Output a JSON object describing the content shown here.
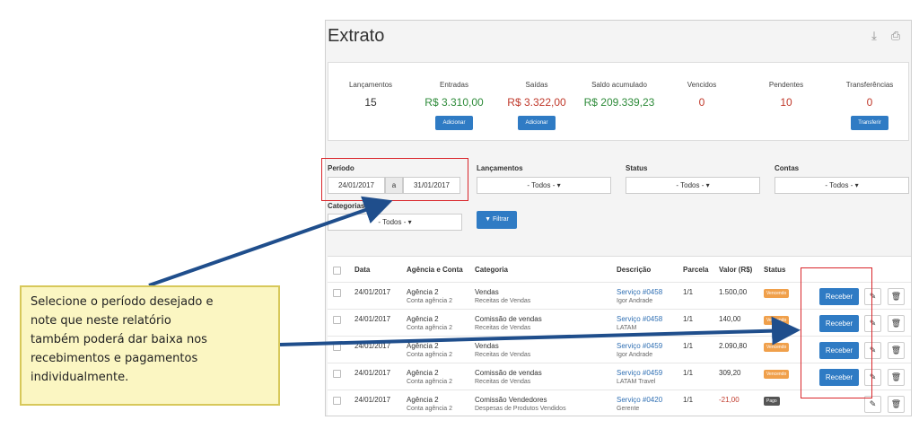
{
  "header": {
    "title": "Extrato",
    "download_icon": "download-icon",
    "print_icon": "print-icon"
  },
  "summary": {
    "lancamentos": {
      "label": "Lançamentos",
      "value": "15"
    },
    "entradas": {
      "label": "Entradas",
      "value": "R$ 3.310,00",
      "button": "Adicionar"
    },
    "saidas": {
      "label": "Saídas",
      "value": "R$ 3.322,00",
      "button": "Adicionar"
    },
    "saldo": {
      "label": "Saldo acumulado",
      "value": "R$ 209.339,23"
    },
    "vencidos": {
      "label": "Vencidos",
      "value": "0"
    },
    "pendentes": {
      "label": "Pendentes",
      "value": "10"
    },
    "transferencias": {
      "label": "Transferências",
      "value": "0",
      "button": "Transferir"
    }
  },
  "filters": {
    "periodo_label": "Período",
    "date_from": "24/01/2017",
    "date_sep": "a",
    "date_to": "31/01/2017",
    "lancamentos_label": "Lançamentos",
    "lancamentos_value": "- Todos -",
    "status_label": "Status",
    "status_value": "- Todos -",
    "contas_label": "Contas",
    "contas_value": "- Todos -",
    "categorias_label": "Categorias",
    "categorias_value": "- Todos -",
    "filter_button": "Filtrar"
  },
  "table": {
    "headers": {
      "data": "Data",
      "agencia": "Agência e Conta",
      "categoria": "Categoria",
      "descricao": "Descrição",
      "parcela": "Parcela",
      "valor": "Valor (R$)",
      "status": "Status"
    },
    "rows": [
      {
        "data": "24/01/2017",
        "agencia": "Agência 2",
        "conta": "Conta agência 2",
        "categoria": "Vendas",
        "subcategoria": "Receitas de Vendas",
        "descricao": "Serviço #0458",
        "cliente": "Igor Andrade",
        "parcela": "1/1",
        "valor": "1.500,00",
        "status": "Vencendo",
        "action": "Receber"
      },
      {
        "data": "24/01/2017",
        "agencia": "Agência 2",
        "conta": "Conta agência 2",
        "categoria": "Comissão de vendas",
        "subcategoria": "Receitas de Vendas",
        "descricao": "Serviço #0458",
        "cliente": "LATAM",
        "parcela": "1/1",
        "valor": "140,00",
        "status": "Vencendo",
        "action": "Receber"
      },
      {
        "data": "24/01/2017",
        "agencia": "Agência 2",
        "conta": "Conta agência 2",
        "categoria": "Vendas",
        "subcategoria": "Receitas de Vendas",
        "descricao": "Serviço #0459",
        "cliente": "Igor Andrade",
        "parcela": "1/1",
        "valor": "2.090,80",
        "status": "Vencendo",
        "action": "Receber"
      },
      {
        "data": "24/01/2017",
        "agencia": "Agência 2",
        "conta": "Conta agência 2",
        "categoria": "Comissão de vendas",
        "subcategoria": "Receitas de Vendas",
        "descricao": "Serviço #0459",
        "cliente": "LATAM Travel",
        "parcela": "1/1",
        "valor": "309,20",
        "status": "Vencendo",
        "action": "Receber"
      },
      {
        "data": "24/01/2017",
        "agencia": "Agência 2",
        "conta": "Conta agência 2",
        "categoria": "Comissão Vendedores",
        "subcategoria": "Despesas de Produtos Vendidos",
        "descricao": "Serviço #0420",
        "cliente": "Gerente",
        "parcela": "1/1",
        "valor": "-21,00",
        "status": "Pago",
        "action": ""
      }
    ]
  },
  "callout": {
    "lines": [
      "Selecione o período desejado e",
      "note que neste relatório",
      "também poderá dar baixa nos",
      "recebimentos e pagamentos",
      "individualmente."
    ]
  },
  "colors": {
    "primary": "#2f7bc4",
    "entradas": "#2e8b3a",
    "saidas": "#c0392b",
    "highlight": "#d9252a",
    "callout_bg": "#fbf6c2",
    "arrow": "#1f4e8c"
  }
}
